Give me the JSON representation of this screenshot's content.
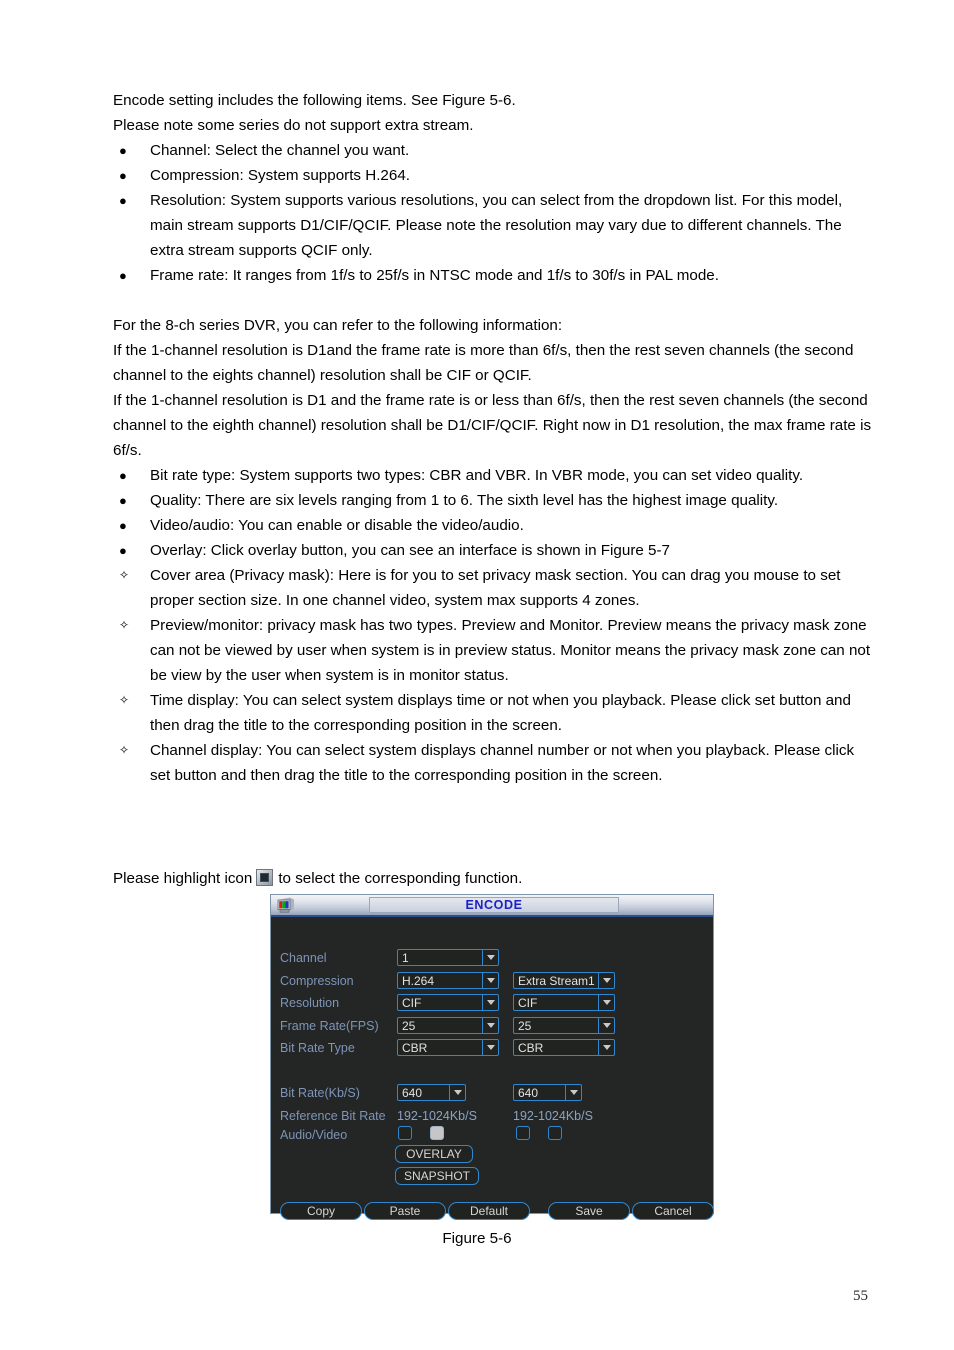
{
  "document": {
    "intro": [
      "Encode setting includes the following items. See Figure 5-6.",
      "Please note some series do not support extra stream."
    ],
    "bullets_1": [
      "Channel: Select the channel you want.",
      "Compression: System supports H.264.",
      "Resolution: System supports various resolutions, you can select from the dropdown list. For this model, main stream supports D1/CIF/QCIF. Please note the resolution may vary due to different channels. The extra stream supports QCIF only.",
      "Frame rate: It ranges from 1f/s to 25f/s in NTSC mode and 1f/s to 30f/s in PAL mode."
    ],
    "middle_paragraph": [
      "For the 8-ch series DVR, you can refer to the following information:",
      "If the 1-channel resolution is D1and the frame rate is more than 6f/s, then the rest seven channels (the second channel to the eights channel) resolution shall be CIF or QCIF.",
      "If the 1-channel resolution is D1 and the frame rate is or less than 6f/s, then the rest seven channels (the second channel to the eighth channel) resolution shall be D1/CIF/QCIF. Right now in D1 resolution, the max frame rate is 6f/s."
    ],
    "bullets_2": [
      "Bit rate type: System supports two types: CBR and VBR. In VBR mode, you can set video quality.",
      "Quality: There are six levels ranging from 1 to 6. The sixth level has the highest image quality.",
      "Video/audio: You can enable or disable the video/audio.",
      "Overlay: Click overlay button, you can see an interface is shown in Figure 5-7"
    ],
    "diamonds": [
      "Cover area (Privacy mask): Here is for you to set privacy mask section. You can drag you mouse to set proper section size. In one channel video, system max supports 4 zones.",
      "Preview/monitor: privacy mask has two types. Preview and Monitor. Preview means the privacy mask zone can not be viewed by user when system is in preview status. Monitor means the privacy mask zone can not be view by the user when system is in monitor status.",
      "Time display: You can select system displays time or not when you playback. Please click set button and then drag the title to the corresponding position in the screen.",
      "Channel display: You can select system displays channel number or not when you playback. Please click set button and then drag the title to the corresponding position in the screen."
    ],
    "highlight_prefix": "Please highlight icon",
    "highlight_suffix": "to select the corresponding function.",
    "bullet_marker": "●",
    "diamond_marker": "✧",
    "figure_caption": "Figure 5-6",
    "page_number": "55"
  },
  "dialog": {
    "title": "ENCODE",
    "title_icon": "monitor-icon",
    "rows": {
      "channel": {
        "label": "Channel",
        "main_value": "1"
      },
      "compression": {
        "label": "Compression",
        "main_value": "H.264",
        "extra_value": "Extra Stream1"
      },
      "resolution": {
        "label": "Resolution",
        "main_value": "CIF",
        "extra_value": "CIF"
      },
      "frame_rate": {
        "label": "Frame Rate(FPS)",
        "main_value": "25",
        "extra_value": "25"
      },
      "bit_rate_type": {
        "label": "Bit Rate Type",
        "main_value": "CBR",
        "extra_value": "CBR"
      },
      "bit_rate": {
        "label": "Bit Rate(Kb/S)",
        "main_value": "640",
        "extra_value": "640"
      },
      "reference_bit_rate": {
        "label": "Reference Bit Rate",
        "main_value": "192-1024Kb/S",
        "extra_value": "192-1024Kb/S"
      },
      "audio_video": {
        "label": "Audio/Video"
      }
    },
    "checkboxes": [
      {
        "name": "main-audio",
        "checked": false
      },
      {
        "name": "main-video",
        "checked": true
      },
      {
        "name": "extra-audio",
        "checked": false
      },
      {
        "name": "extra-video",
        "checked": false
      }
    ],
    "overlay_button": "OVERLAY",
    "snapshot_button": "SNAPSHOT",
    "footer_buttons": {
      "copy": "Copy",
      "paste": "Paste",
      "default": "Default",
      "save": "Save",
      "cancel": "Cancel"
    },
    "colors": {
      "panel_bg": "#232625",
      "border_blue": "#2f87d0",
      "label_blue": "#7e94b8",
      "title_text": "#1c22c4",
      "checked_fill": "#c6c6c6"
    }
  }
}
